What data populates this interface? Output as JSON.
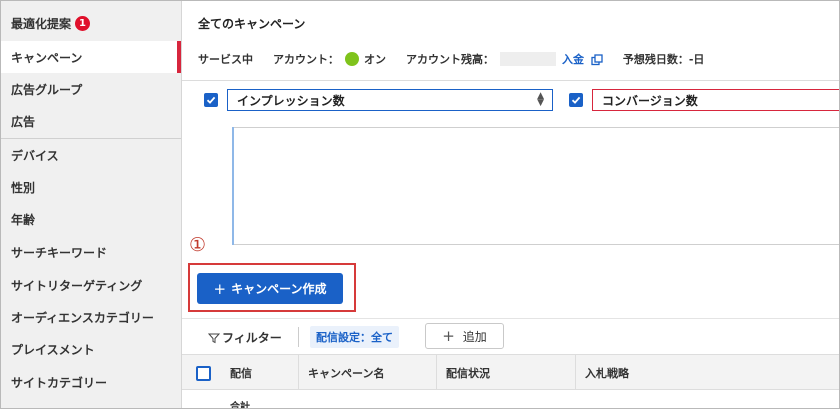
{
  "sidebar": {
    "items": [
      {
        "label": "最適化提案",
        "badge": "1"
      },
      {
        "label": "キャンペーン"
      },
      {
        "label": "広告グループ"
      },
      {
        "label": "広告"
      },
      {
        "label": "デバイス"
      },
      {
        "label": "性別"
      },
      {
        "label": "年齢"
      },
      {
        "label": "サーチキーワード"
      },
      {
        "label": "サイトリターゲティング"
      },
      {
        "label": "オーディエンスカテゴリー"
      },
      {
        "label": "プレイスメント"
      },
      {
        "label": "サイトカテゴリー"
      }
    ]
  },
  "header": {
    "title": "全てのキャンペーン",
    "status": "サービス中",
    "account_label": "アカウント：",
    "account_status": "オン",
    "balance_label": "アカウント残高：",
    "deposit_link": "入金",
    "days_label": "予想残日数：-日"
  },
  "graph": {
    "metric1": "インプレッション数",
    "metric2": "コンバージョン数"
  },
  "annotation": {
    "step": "①"
  },
  "actions": {
    "create_campaign": "キャンペーン作成",
    "plus": "+"
  },
  "filter": {
    "filter_label": "フィルター",
    "chip": "配信設定：全て",
    "add_label": "追加"
  },
  "table": {
    "columns": [
      "配信",
      "キャンペーン名",
      "配信状況",
      "入札戦略"
    ],
    "total_label": "合計"
  },
  "colors": {
    "accent": "#1a61c7",
    "active_marker": "#d7263d",
    "badge": "#e0102b",
    "status_on": "#7fc31c"
  }
}
